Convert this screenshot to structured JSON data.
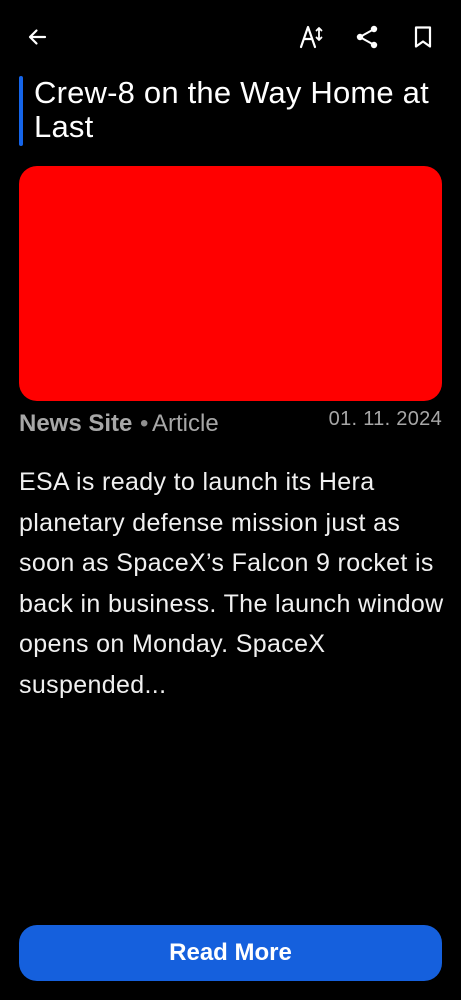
{
  "header": {
    "back_icon": "arrow-left-icon",
    "text_size_icon": "text-size-icon",
    "share_icon": "share-icon",
    "bookmark_icon": "bookmark-icon"
  },
  "article": {
    "title": "Crew-8 on the Way Home at Last",
    "image_placeholder_color": "#ff0000",
    "source": "News Site",
    "separator": "•",
    "type": "Article",
    "date": "01. 11. 2024",
    "summary": "ESA is ready to launch its Hera planetary defense mission just as soon as SpaceX’s Falcon 9 rocket is back in business. The launch window opens on Monday. SpaceX suspended..."
  },
  "actions": {
    "read_more_label": "Read More"
  },
  "colors": {
    "accent": "#1565ea",
    "button": "#1560dd",
    "background": "#000000"
  }
}
